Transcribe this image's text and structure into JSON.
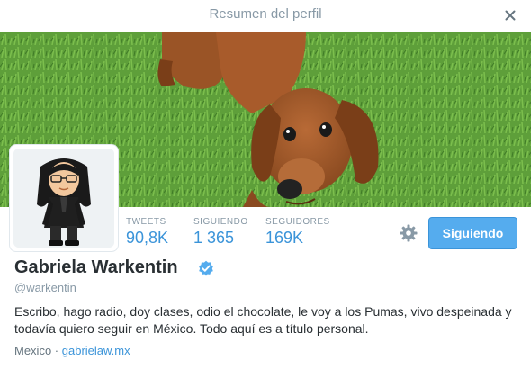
{
  "modal": {
    "title": "Resumen del perfil"
  },
  "icons": {
    "close": "close-icon",
    "settings": "gear-icon",
    "verified": "verified-badge-icon"
  },
  "colors": {
    "accent": "#55acee",
    "link": "#3b94d9",
    "muted": "#8899a6",
    "text": "#292f33"
  },
  "stats": [
    {
      "label": "TWEETS",
      "value": "90,8K"
    },
    {
      "label": "SIGUIENDO",
      "value": "1 365"
    },
    {
      "label": "SEGUIDORES",
      "value": "169K"
    }
  ],
  "follow_button": {
    "label": "Siguiendo"
  },
  "profile": {
    "name": "Gabriela Warkentin",
    "handle": "@warkentin",
    "bio": "Escribo, hago radio, doy clases, odio el chocolate, le voy a los Pumas, vivo despeinada y todavía quiero seguir en México. Todo aquí es a título personal.",
    "location": "Mexico",
    "separator": " · ",
    "website": "gabrielaw.mx"
  }
}
